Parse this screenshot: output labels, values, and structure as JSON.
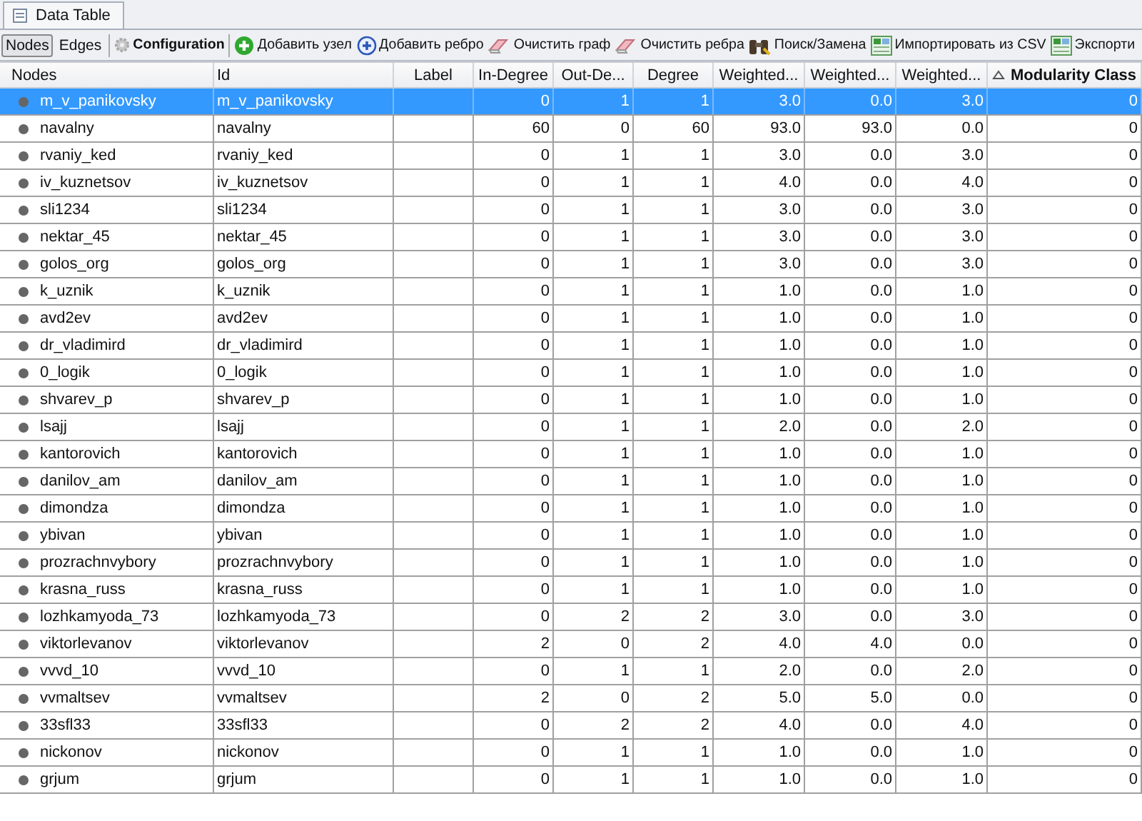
{
  "window": {
    "title": "Data Table"
  },
  "toolbar": {
    "views": [
      {
        "label": "Nodes",
        "selected": true
      },
      {
        "label": "Edges",
        "selected": false
      }
    ],
    "configuration": "Configuration",
    "actions": [
      {
        "kind": "add-node",
        "label": "Добавить узел"
      },
      {
        "kind": "add-edge",
        "label": "Добавить ребро"
      },
      {
        "kind": "clear",
        "label": "Очистить граф"
      },
      {
        "kind": "clear",
        "label": "Очистить ребра"
      },
      {
        "kind": "search",
        "label": "Поиск/Замена"
      },
      {
        "kind": "import",
        "label": "Импортировать из CSV"
      },
      {
        "kind": "import",
        "label": "Экспорти"
      }
    ]
  },
  "table": {
    "columns": [
      {
        "label": "Nodes",
        "kind": "node",
        "sorted": false
      },
      {
        "label": "Id",
        "kind": "text",
        "sorted": false
      },
      {
        "label": "Label",
        "kind": "label",
        "sorted": false
      },
      {
        "label": "In-Degree",
        "kind": "number",
        "sorted": false
      },
      {
        "label": "Out-De...",
        "kind": "number",
        "sorted": false
      },
      {
        "label": "Degree",
        "kind": "number",
        "sorted": false
      },
      {
        "label": "Weighted...",
        "kind": "number",
        "sorted": false
      },
      {
        "label": "Weighted...",
        "kind": "number",
        "sorted": false
      },
      {
        "label": "Weighted...",
        "kind": "number",
        "sorted": false
      },
      {
        "label": "Modularity Class",
        "kind": "number",
        "sorted": true
      }
    ],
    "rows": [
      {
        "selected": true,
        "values": [
          "m_v_panikovsky",
          "m_v_panikovsky",
          "0",
          "1",
          "1",
          "3.0",
          "0.0",
          "3.0",
          "0"
        ]
      },
      {
        "selected": false,
        "values": [
          "navalny",
          "navalny",
          "60",
          "0",
          "60",
          "93.0",
          "93.0",
          "0.0",
          "0"
        ]
      },
      {
        "selected": false,
        "values": [
          "rvaniy_ked",
          "rvaniy_ked",
          "0",
          "1",
          "1",
          "3.0",
          "0.0",
          "3.0",
          "0"
        ]
      },
      {
        "selected": false,
        "values": [
          "iv_kuznetsov",
          "iv_kuznetsov",
          "0",
          "1",
          "1",
          "4.0",
          "0.0",
          "4.0",
          "0"
        ]
      },
      {
        "selected": false,
        "values": [
          "sli1234",
          "sli1234",
          "0",
          "1",
          "1",
          "3.0",
          "0.0",
          "3.0",
          "0"
        ]
      },
      {
        "selected": false,
        "values": [
          "nektar_45",
          "nektar_45",
          "0",
          "1",
          "1",
          "3.0",
          "0.0",
          "3.0",
          "0"
        ]
      },
      {
        "selected": false,
        "values": [
          "golos_org",
          "golos_org",
          "0",
          "1",
          "1",
          "3.0",
          "0.0",
          "3.0",
          "0"
        ]
      },
      {
        "selected": false,
        "values": [
          "k_uznik",
          "k_uznik",
          "0",
          "1",
          "1",
          "1.0",
          "0.0",
          "1.0",
          "0"
        ]
      },
      {
        "selected": false,
        "values": [
          "avd2ev",
          "avd2ev",
          "0",
          "1",
          "1",
          "1.0",
          "0.0",
          "1.0",
          "0"
        ]
      },
      {
        "selected": false,
        "values": [
          "dr_vladimird",
          "dr_vladimird",
          "0",
          "1",
          "1",
          "1.0",
          "0.0",
          "1.0",
          "0"
        ]
      },
      {
        "selected": false,
        "values": [
          "0_logik",
          "0_logik",
          "0",
          "1",
          "1",
          "1.0",
          "0.0",
          "1.0",
          "0"
        ]
      },
      {
        "selected": false,
        "values": [
          "shvarev_p",
          "shvarev_p",
          "0",
          "1",
          "1",
          "1.0",
          "0.0",
          "1.0",
          "0"
        ]
      },
      {
        "selected": false,
        "values": [
          "lsajj",
          "lsajj",
          "0",
          "1",
          "1",
          "2.0",
          "0.0",
          "2.0",
          "0"
        ]
      },
      {
        "selected": false,
        "values": [
          "kantorovich",
          "kantorovich",
          "0",
          "1",
          "1",
          "1.0",
          "0.0",
          "1.0",
          "0"
        ]
      },
      {
        "selected": false,
        "values": [
          "danilov_am",
          "danilov_am",
          "0",
          "1",
          "1",
          "1.0",
          "0.0",
          "1.0",
          "0"
        ]
      },
      {
        "selected": false,
        "values": [
          "dimondza",
          "dimondza",
          "0",
          "1",
          "1",
          "1.0",
          "0.0",
          "1.0",
          "0"
        ]
      },
      {
        "selected": false,
        "values": [
          "ybivan",
          "ybivan",
          "0",
          "1",
          "1",
          "1.0",
          "0.0",
          "1.0",
          "0"
        ]
      },
      {
        "selected": false,
        "values": [
          "prozrachnvybory",
          "prozrachnvybory",
          "0",
          "1",
          "1",
          "1.0",
          "0.0",
          "1.0",
          "0"
        ]
      },
      {
        "selected": false,
        "values": [
          "krasna_russ",
          "krasna_russ",
          "0",
          "1",
          "1",
          "1.0",
          "0.0",
          "1.0",
          "0"
        ]
      },
      {
        "selected": false,
        "values": [
          "lozhkamyoda_73",
          "lozhkamyoda_73",
          "0",
          "2",
          "2",
          "3.0",
          "0.0",
          "3.0",
          "0"
        ]
      },
      {
        "selected": false,
        "values": [
          "viktorlevanov",
          "viktorlevanov",
          "2",
          "0",
          "2",
          "4.0",
          "4.0",
          "0.0",
          "0"
        ]
      },
      {
        "selected": false,
        "values": [
          "vvvd_10",
          "vvvd_10",
          "0",
          "1",
          "1",
          "2.0",
          "0.0",
          "2.0",
          "0"
        ]
      },
      {
        "selected": false,
        "values": [
          "vvmaltsev",
          "vvmaltsev",
          "2",
          "0",
          "2",
          "5.0",
          "5.0",
          "0.0",
          "0"
        ]
      },
      {
        "selected": false,
        "values": [
          "33sfl33",
          "33sfl33",
          "0",
          "2",
          "2",
          "4.0",
          "0.0",
          "4.0",
          "0"
        ]
      },
      {
        "selected": false,
        "values": [
          "nickonov",
          "nickonov",
          "0",
          "1",
          "1",
          "1.0",
          "0.0",
          "1.0",
          "0"
        ]
      },
      {
        "selected": false,
        "values": [
          "grjum",
          "grjum",
          "0",
          "1",
          "1",
          "1.0",
          "0.0",
          "1.0",
          "0"
        ]
      }
    ]
  }
}
